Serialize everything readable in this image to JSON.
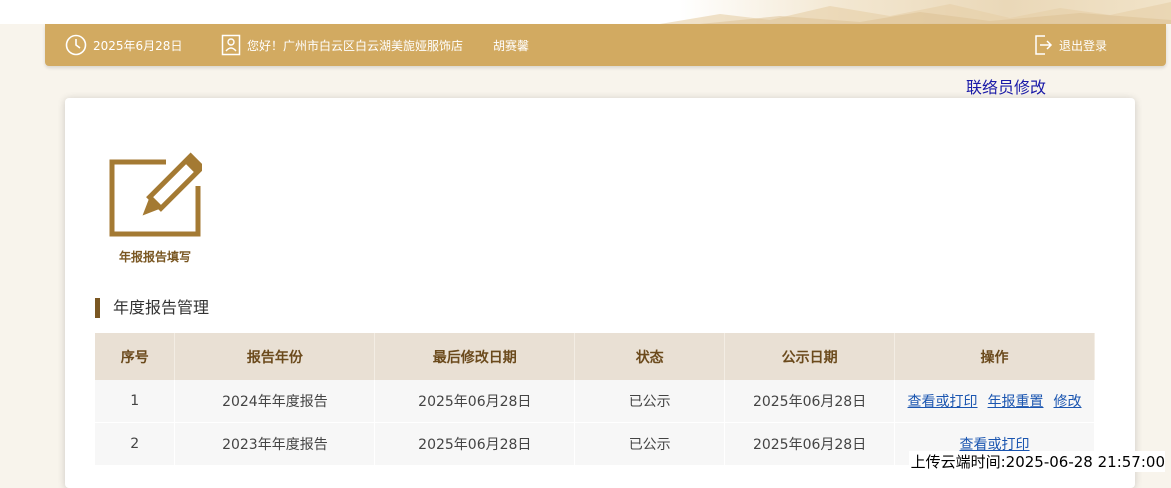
{
  "header": {
    "date": "2025年6月28日",
    "greeting": "您好！广州市白云区白云湖美旎娅服饰店",
    "user": "胡赛馨",
    "logout": "退出登录"
  },
  "contact_edit": "联络员修改",
  "report_entry": {
    "label": "年报报告填写"
  },
  "section_title": "年度报告管理",
  "table": {
    "headers": [
      "序号",
      "报告年份",
      "最后修改日期",
      "状态",
      "公示日期",
      "操作"
    ],
    "rows": [
      {
        "no": "1",
        "year": "2024年年度报告",
        "modified": "2025年06月28日",
        "status": "已公示",
        "published": "2025年06月28日",
        "actions": [
          "查看或打印",
          "年报重置",
          "修改"
        ]
      },
      {
        "no": "2",
        "year": "2023年年度报告",
        "modified": "2025年06月28日",
        "status": "已公示",
        "published": "2025年06月28日",
        "actions": [
          "查看或打印"
        ]
      }
    ]
  },
  "upload_time": "上传云端时间:2025-06-28 21:57:00",
  "colors": {
    "header": "#d2aa61",
    "accent": "#7a5722",
    "link": "#1a55b0"
  },
  "icons": [
    "clock-icon",
    "person-id-icon",
    "logout-icon",
    "edit-pencil-icon"
  ]
}
